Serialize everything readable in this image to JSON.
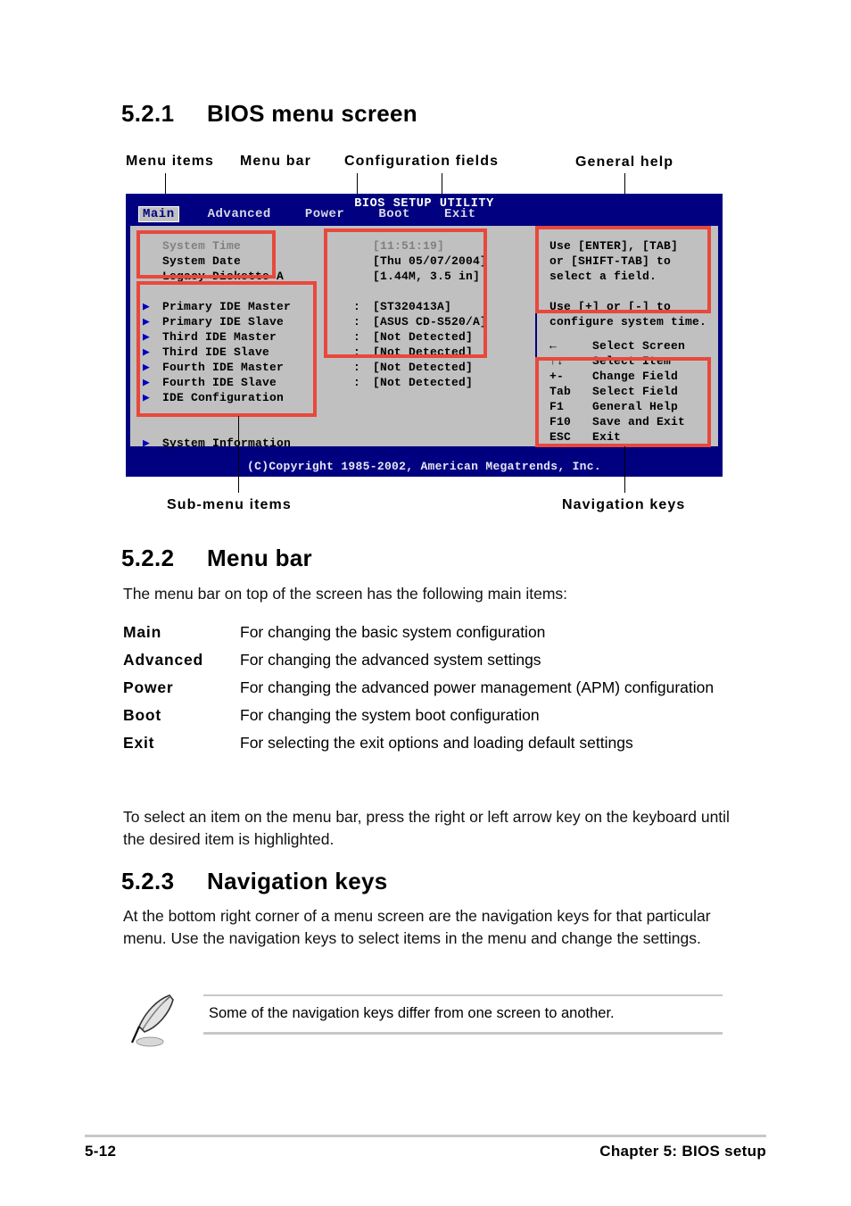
{
  "sections": {
    "s521": {
      "number": "5.2.1",
      "title": "BIOS menu screen"
    },
    "s522": {
      "number": "5.2.2",
      "title": "Menu bar"
    },
    "s523": {
      "number": "5.2.3",
      "title": "Navigation keys"
    }
  },
  "callouts": {
    "menu_items": "Menu items",
    "menu_bar": "Menu bar",
    "config_fields": "Configuration fields",
    "general_help": "General help",
    "submenu_items": "Sub-menu items",
    "navigation_keys": "Navigation keys"
  },
  "bios": {
    "title": "BIOS SETUP UTILITY",
    "copyright": "(C)Copyright 1985-2002, American Megatrends, Inc.",
    "tabs": [
      {
        "label": "Main",
        "active": true
      },
      {
        "label": "Advanced",
        "active": false
      },
      {
        "label": "Power",
        "active": false
      },
      {
        "label": "Boot",
        "active": false
      },
      {
        "label": "Exit",
        "active": false
      }
    ],
    "settings": [
      {
        "arrow": "",
        "label": "System Time",
        "colon": "",
        "value": "[11:51:19]",
        "dim": true
      },
      {
        "arrow": "",
        "label": "System Date",
        "colon": "",
        "value": "[Thu 05/07/2004]",
        "dim": false
      },
      {
        "arrow": "",
        "label": "Legacy Diskette A",
        "colon": "",
        "value": "[1.44M, 3.5 in]",
        "dim": false
      }
    ],
    "submenus": [
      {
        "arrow": "▶",
        "label": "Primary IDE Master",
        "colon": ":",
        "value": "[ST320413A]"
      },
      {
        "arrow": "▶",
        "label": "Primary IDE Slave",
        "colon": ":",
        "value": "[ASUS CD-S520/A]"
      },
      {
        "arrow": "▶",
        "label": "Third IDE Master",
        "colon": ":",
        "value": "[Not Detected]"
      },
      {
        "arrow": "▶",
        "label": "Third IDE Slave",
        "colon": ":",
        "value": "[Not Detected]"
      },
      {
        "arrow": "▶",
        "label": "Fourth IDE Master",
        "colon": ":",
        "value": "[Not Detected]"
      },
      {
        "arrow": "▶",
        "label": "Fourth IDE Slave",
        "colon": ":",
        "value": "[Not Detected]"
      },
      {
        "arrow": "▶",
        "label": "IDE Configuration",
        "colon": "",
        "value": ""
      }
    ],
    "system_info": {
      "arrow": "▶",
      "label": "System Information",
      "colon": "",
      "value": ""
    },
    "help_lines": [
      "Use [ENTER], [TAB]",
      "or [SHIFT-TAB] to",
      "select a field.",
      "",
      "Use [+] or [-] to",
      "configure system time."
    ],
    "nav_keys": [
      {
        "key": "←",
        "desc": "Select Screen"
      },
      {
        "key": "↑↓",
        "desc": "Select Item"
      },
      {
        "key": "+-",
        "desc": "Change Field"
      },
      {
        "key": "Tab",
        "desc": "Select Field"
      },
      {
        "key": "F1",
        "desc": "General Help"
      },
      {
        "key": "F10",
        "desc": "Save and Exit"
      },
      {
        "key": "ESC",
        "desc": "Exit"
      }
    ],
    "colors": {
      "title_bar": "#000080",
      "body": "#c0c0c0",
      "annotation": "#e8483c",
      "arrow": "#0000c0"
    }
  },
  "menu_bar_section": {
    "intro": "The menu bar on top of the screen has the following main items:",
    "items": [
      {
        "term": "Main",
        "desc": "For changing the basic system configuration"
      },
      {
        "term": "Advanced",
        "desc": "For changing the advanced system settings"
      },
      {
        "term": "Power",
        "desc": "For changing the advanced power management (APM) configuration"
      },
      {
        "term": "Boot",
        "desc": "For changing the system boot configuration"
      },
      {
        "term": "Exit",
        "desc": "For selecting the exit options and loading default settings"
      }
    ],
    "outro": "To select an item on the menu bar, press the right or left arrow key on the keyboard until the desired item is highlighted."
  },
  "navigation_keys_section": {
    "body": "At the bottom right corner of a menu screen are the navigation keys for that particular menu. Use the navigation keys to select items in the menu and change the settings."
  },
  "note": {
    "text": "Some of the navigation keys differ from one screen to another.",
    "icon": "quill-pen-icon"
  },
  "footer": {
    "page": "5-12",
    "chapter": "Chapter 5: BIOS setup"
  }
}
